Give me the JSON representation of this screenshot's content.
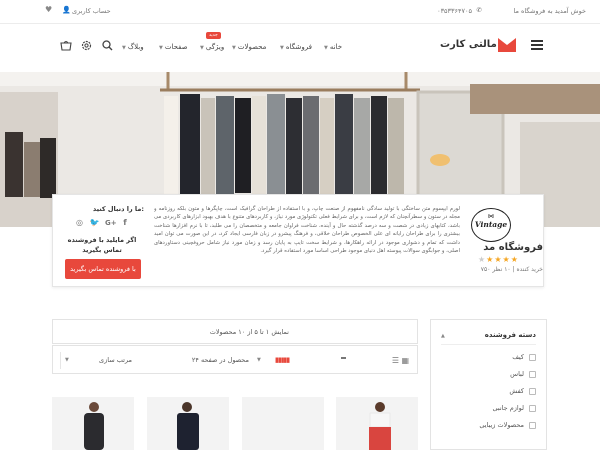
{
  "topbar": {
    "welcome": "خوش آمدید به فروشگاه ما",
    "phone": "۰۳۵۳۳۶۴۷۰۵",
    "account": "حساب کاربری"
  },
  "header": {
    "logo_text": "مالتی کارت",
    "nav": [
      {
        "label": "خانه"
      },
      {
        "label": "فروشگاه"
      },
      {
        "label": "محصولات"
      },
      {
        "label": "ویژگی",
        "badge": "جدید"
      },
      {
        "label": "صفحات"
      },
      {
        "label": "وبلاگ"
      }
    ]
  },
  "vendor": {
    "badge_text": "Vintage",
    "name": "فروشگاه مد",
    "rating_text": "۷۵۰ خرید کننده | ۱۰ نظر",
    "stars": 4,
    "description": "لورم ایپسوم متن ساختگی با تولید سادگی نامفهوم از صنعت چاپ، و با استفاده از طراحان گرافیک است، چاپگرها و متون بلکه روزنامه و مجله در ستون و سطرآنچنان که لازم است، و برای شرایط فعلی تکنولوژی مورد نیاز، و کاربردهای متنوع با هدف بهبود ابزارهای کاربردی می باشد، کتابهای زیادی در شصت و سه درصد گذشته حال و آینده، شناخت فراوان جامعه و متخصصان را می طلبد، تا با نرم افزارها شناخت بیشتری را برای طراحان رایانه ای علی الخصوص طراحان خلاقی، و فرهنگ پیشرو در زبان فارسی ایجاد کرد، در این صورت می توان امید داشت که تمام و دشواری موجود در ارائه راهکارها، و شرایط سخت تایپ به پایان رسد و زمان مورد نیاز شامل حروفچینی دستاوردهای اصلی، و جوابگوی سوالات پیوسته اهل دنیای موجود طراحی اساسا مورد استفاده قرار گیرد.",
    "follow_title": "ما را دنبال کنید:",
    "contact_text": "اگر مایلید با فروشنده تماس بگیرید",
    "contact_button": "با فروشنده تماس بگیرید"
  },
  "sidebar": {
    "title": "دسته فروشنده",
    "categories": [
      "کیف",
      "لباس",
      "کفش",
      "لوازم جانبی",
      "محصولات زیبایی"
    ]
  },
  "listing": {
    "result_text": "نمایش ۱ تا ۵ از ۱۰ محصولات",
    "per_page": "۲۴ محصول در صفحه",
    "sort_label": "مرتب سازی"
  },
  "colors": {
    "accent": "#e8483c",
    "star": "#f5a623",
    "logo": "#e8483c"
  }
}
